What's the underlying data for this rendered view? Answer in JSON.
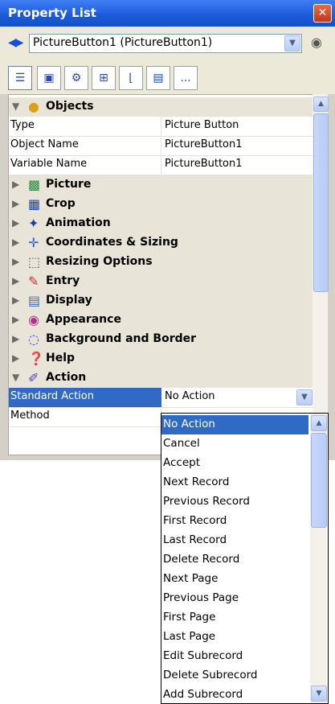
{
  "window": {
    "title": "Property List"
  },
  "object_selector": {
    "value": "PictureButton1 (PictureButton1)"
  },
  "tabs": [
    {
      "icon": "list-icon"
    },
    {
      "icon": "form-icon"
    },
    {
      "icon": "gear-icon"
    },
    {
      "icon": "objects-icon"
    },
    {
      "icon": "chart-icon"
    },
    {
      "icon": "display-icon"
    },
    {
      "icon": "more-icon",
      "label": "..."
    }
  ],
  "objects_section": {
    "label": "Objects",
    "rows": [
      {
        "name": "Type",
        "value": "Picture Button"
      },
      {
        "name": "Object Name",
        "value": "PictureButton1"
      },
      {
        "name": "Variable Name",
        "value": "PictureButton1"
      }
    ]
  },
  "sections": [
    {
      "label": "Picture",
      "icon": "picture-icon"
    },
    {
      "label": "Crop",
      "icon": "crop-icon"
    },
    {
      "label": "Animation",
      "icon": "animation-icon"
    },
    {
      "label": "Coordinates & Sizing",
      "icon": "coordinates-icon"
    },
    {
      "label": "Resizing Options",
      "icon": "resize-icon"
    },
    {
      "label": "Entry",
      "icon": "entry-icon"
    },
    {
      "label": "Display",
      "icon": "display-icon"
    },
    {
      "label": "Appearance",
      "icon": "appearance-icon"
    },
    {
      "label": "Background and Border",
      "icon": "background-icon"
    },
    {
      "label": "Help",
      "icon": "help-icon"
    }
  ],
  "action_section": {
    "label": "Action",
    "rows": [
      {
        "name": "Standard Action",
        "value": "No Action"
      },
      {
        "name": "Method",
        "value": ""
      }
    ]
  },
  "dropdown": {
    "selected": "No Action",
    "options": [
      "No Action",
      "Cancel",
      "Accept",
      "Next Record",
      "Previous Record",
      "First Record",
      "Last Record",
      "Delete Record",
      "Next Page",
      "Previous Page",
      "First Page",
      "Last Page",
      "Edit Subrecord",
      "Delete Subrecord",
      "Add Subrecord"
    ]
  }
}
